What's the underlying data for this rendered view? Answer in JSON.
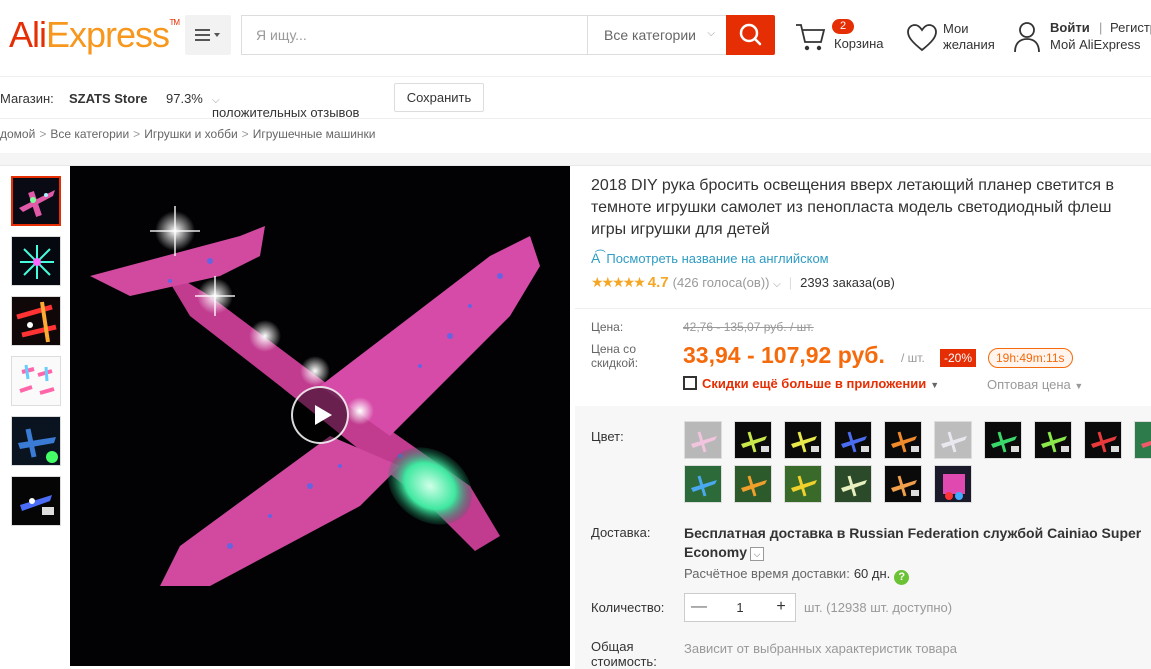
{
  "header": {
    "logo_part1": "Ali",
    "logo_part2": "Express",
    "logo_tm": "TM",
    "search_placeholder": "Я ищу...",
    "search_category": "Все категории",
    "cart_count": "2",
    "cart_label": "Корзина",
    "wishlist_label": "Мои желания",
    "login_label": "Войти",
    "register_label": "Регистрация",
    "account_label": "Мой AliExpress",
    "accent_color": "#e62e04"
  },
  "store": {
    "label": "Магазин:",
    "name": "SZATS Store",
    "rating": "97.3%",
    "rating_label": "положительных отзывов",
    "save_label": "Сохранить"
  },
  "breadcrumb": [
    "домой",
    "Все категории",
    "Игрушки и хобби",
    "Игрушечные машинки"
  ],
  "product": {
    "title": "2018 DIY рука бросить освещения вверх летающий планер светится в темноте игрушки самолет из пенопласта модель светодиодный флеш игры игрушки для детей",
    "translate_label": "Посмотреть название на английском",
    "stars": "★★★★★",
    "rating_value": "4.7",
    "rating_count": "(426 голоса(ов))",
    "orders": "2393 заказа(ов)"
  },
  "price": {
    "label": "Цена:",
    "old": "42,76 - 135,07 руб. / шт.",
    "discount_label": "Цена со скидкой:",
    "new": "33,94 - 107,92 руб.",
    "unit": "/ шт.",
    "discount_badge": "-20%",
    "timer": "19h:49m:11s",
    "app_promo": "Скидки ещё больше в приложении",
    "wholesale": "Оптовая цена"
  },
  "options": {
    "color_label": "Цвет:",
    "shipping_label": "Доставка:",
    "shipping_text_prefix": "Бесплатная доставка в ",
    "shipping_text_dest": "Russian Federation службой Cainiao Super Economy",
    "shipping_est_label": "Расчётное время доставки:",
    "shipping_days": "60 дн.",
    "quantity_label": "Количество:",
    "quantity_value": "1",
    "quantity_available": "шт. (12938 шт. доступно)",
    "total_label": "Общая стоимость:",
    "total_value": "Зависит от выбранных характеристик товара"
  }
}
